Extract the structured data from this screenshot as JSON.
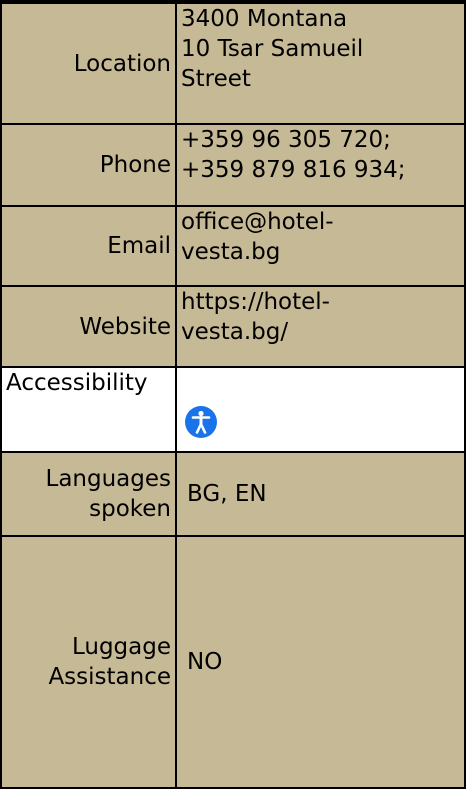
{
  "rows": {
    "location": {
      "label": "Location",
      "value_lines": [
        "3400 Montana",
        "10 Tsar Samueil",
        "Street"
      ]
    },
    "phone": {
      "label": "Phone",
      "value_lines": [
        "+359 96 305 720;",
        "+359 879 816 934;"
      ]
    },
    "email": {
      "label": "Email",
      "value_lines": [
        "office@hotel-",
        "vesta.bg"
      ]
    },
    "website": {
      "label": "Website",
      "value_lines": [
        "https://hotel-",
        "vesta.bg/"
      ]
    },
    "accessibility": {
      "label": "Accessibility",
      "icon": "accessibility-icon",
      "icon_color": "#1a73e8"
    },
    "languages": {
      "label_lines": [
        "Languages",
        "spoken"
      ],
      "value": "BG, EN"
    },
    "luggage": {
      "label_lines": [
        "Luggage",
        "Assistance"
      ],
      "value": "NO"
    }
  },
  "colors": {
    "row_background": "#c6b995",
    "highlight_row_background": "#ffffff",
    "border": "#000000"
  }
}
